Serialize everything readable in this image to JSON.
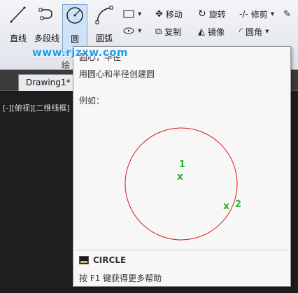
{
  "ribbon": {
    "draw_tools": [
      {
        "label": "直线",
        "icon": "line-icon"
      },
      {
        "label": "多段线",
        "icon": "polyline-icon"
      },
      {
        "label": "圆",
        "icon": "circle-icon"
      },
      {
        "label": "圆弧",
        "icon": "arc-icon"
      }
    ],
    "modify_tools": [
      {
        "label": "移动",
        "icon": "move-icon"
      },
      {
        "label": "旋转",
        "icon": "rotate-icon"
      },
      {
        "label": "修剪",
        "icon": "trim-icon"
      },
      {
        "label": "复制",
        "icon": "copy-icon"
      },
      {
        "label": "镜像",
        "icon": "mirror-icon"
      },
      {
        "label": "圆角",
        "icon": "fillet-icon"
      }
    ],
    "panel_title": "绘"
  },
  "watermark": "www.rjzxw.com",
  "tabs": [
    "Drawing1*"
  ],
  "viewport_label": "[-][俯视][二维线框]",
  "tooltip": {
    "title": "圆心，半径",
    "description": "用圆心和半径创建圆",
    "example_label": "例如：",
    "point1": "1",
    "point2": "2",
    "marker": "x",
    "command": "CIRCLE",
    "help": "按 F1 键获得更多帮助"
  },
  "colors": {
    "circle": "#e0141e",
    "marker": "#2db62d",
    "label": "#2db62d"
  }
}
